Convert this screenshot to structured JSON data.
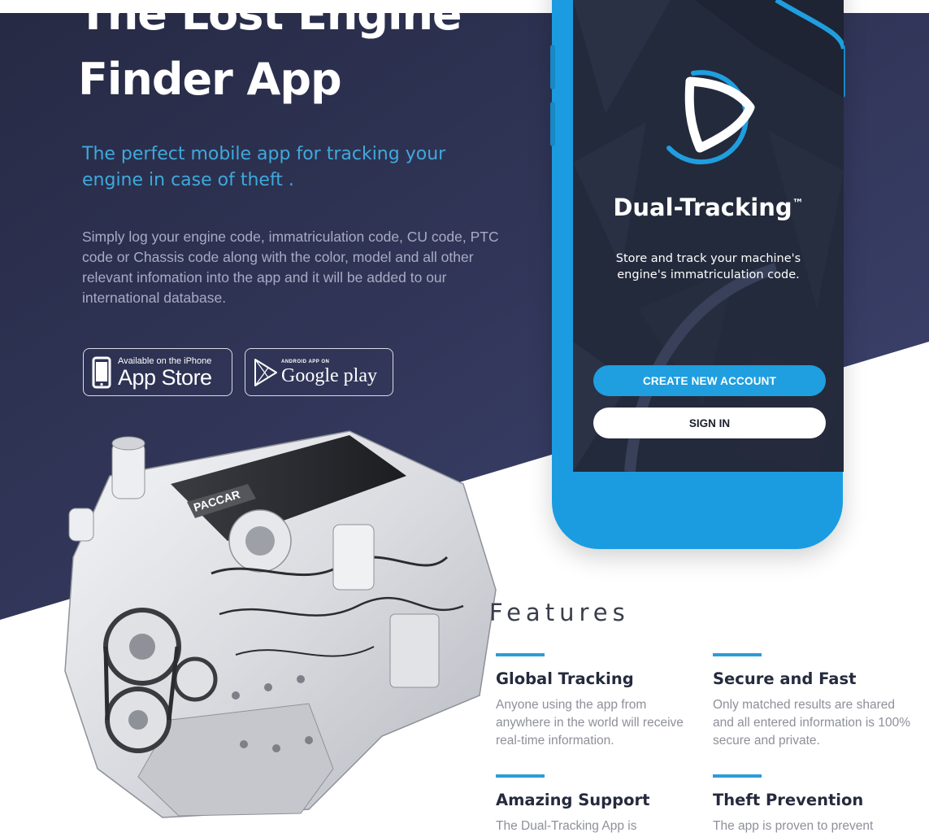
{
  "hero": {
    "title_line1": "The Lost Engine",
    "title_line2": "Finder App",
    "subtitle": "The perfect mobile app for tracking your engine in case of theft .",
    "description": "Simply log your engine code, immatriculation code, CU code, PTC code or Chassis code along with the color, model and all other relevant infomation into the app and it will be added to our international database."
  },
  "badges": {
    "app_store": {
      "small": "Available on the iPhone",
      "big": "App Store"
    },
    "google_play": {
      "small": "ANDROID APP ON",
      "big": "Google play"
    }
  },
  "engine": {
    "brand": "PACCAR"
  },
  "phone": {
    "app_name": "Dual-Tracking",
    "trademark": "™",
    "tagline": "Store and track your machine's engine's immatriculation code.",
    "create_button": "CREATE NEW ACCOUNT",
    "signin_button": "SIGN IN"
  },
  "features": {
    "heading": "Features",
    "items": [
      {
        "title": "Global Tracking",
        "desc": "Anyone using the app from anywhere in the world will receive real-time information."
      },
      {
        "title": "Secure and Fast",
        "desc": "Only matched results are shared and all entered information is 100% secure and private."
      },
      {
        "title": "Amazing Support",
        "desc": "The Dual-Tracking App is"
      },
      {
        "title": "Theft Prevention",
        "desc": "The app is proven to prevent"
      }
    ]
  },
  "colors": {
    "hero_bg_top": "#2a2e4a",
    "hero_bg_bottom": "#3a3f68",
    "accent_blue": "#1f9ee0",
    "subtitle_blue": "#3fa9dc",
    "phone_screen": "#232a3b"
  },
  "icons": [
    "apple-phone-icon",
    "play-triangle-icon",
    "dual-tracking-logo-icon"
  ]
}
